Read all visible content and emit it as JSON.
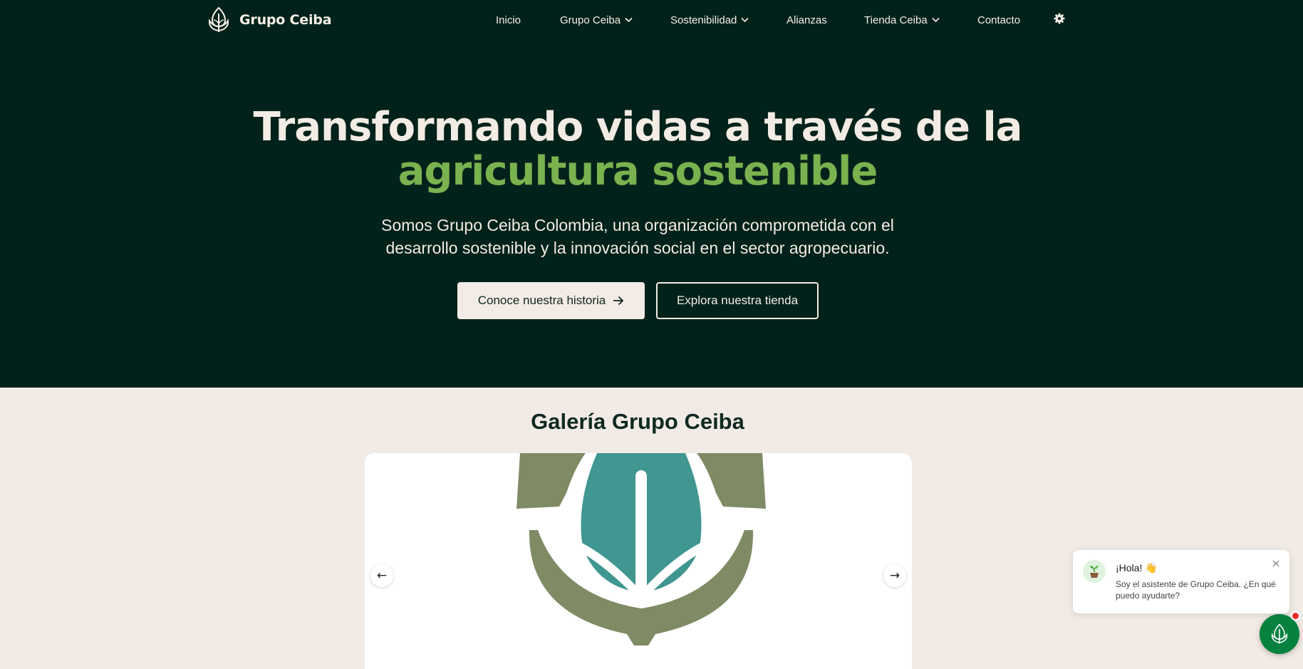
{
  "brand": {
    "name": "Grupo Ceiba",
    "logo_icon": "leaf-logo-icon"
  },
  "nav": {
    "items": [
      {
        "label": "Inicio",
        "has_dropdown": false
      },
      {
        "label": "Grupo Ceiba",
        "has_dropdown": true
      },
      {
        "label": "Sostenibilidad",
        "has_dropdown": true
      },
      {
        "label": "Alianzas",
        "has_dropdown": false
      },
      {
        "label": "Tienda Ceiba",
        "has_dropdown": true
      },
      {
        "label": "Contacto",
        "has_dropdown": false
      }
    ],
    "settings_icon": "gear-icon"
  },
  "hero": {
    "title_line1": "Transformando vidas a través de la",
    "title_line2": "agricultura sostenible",
    "subtitle": "Somos Grupo Ceiba Colombia, una organización comprometida con el desarrollo sostenible y la innovación social en el sector agropecuario.",
    "primary_button": "Conoce nuestra historia",
    "secondary_button": "Explora nuestra tienda"
  },
  "gallery": {
    "title": "Galería Grupo Ceiba",
    "prev": "←",
    "next": "→"
  },
  "chat": {
    "greeting": "¡Hola! 👋",
    "message": "Soy el asistente de Grupo Ceiba. ¿En qué puedo ayudarte?"
  },
  "colors": {
    "hero_bg": "#01221a",
    "accent_green": "#7ab24f",
    "cream": "#f2ebe5",
    "chat_green": "#06813f",
    "logo_olive": "#7f8b64",
    "logo_teal": "#409690",
    "notification_red": "#ee2a2a"
  }
}
